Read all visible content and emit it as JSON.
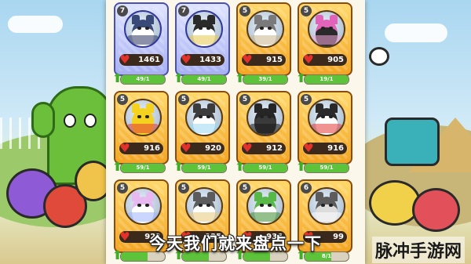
{
  "cards": [
    {
      "level": "7",
      "hp": "1461",
      "progress": "49/1",
      "fill": 1.0,
      "style": "blue",
      "face": "#3a4a78",
      "fur": "#ffffff",
      "accent": "#2d3561",
      "name": "dark-blue-dog"
    },
    {
      "level": "7",
      "hp": "1433",
      "progress": "49/1",
      "fill": 1.0,
      "style": "blue",
      "face": "#2a2a2a",
      "fur": "#ffffff",
      "accent": "#e7c84a",
      "name": "crowned-dog"
    },
    {
      "level": "5",
      "hp": "915",
      "progress": "39/1",
      "fill": 1.0,
      "style": "gold",
      "face": "#7a7a7a",
      "fur": "#ffffff",
      "accent": "#c9b58a",
      "name": "helmet-dog"
    },
    {
      "level": "5",
      "hp": "905",
      "progress": "19/1",
      "fill": 1.0,
      "style": "gold",
      "face": "#e264b8",
      "fur": "#2a2a2a",
      "accent": "#f2a6d8",
      "name": "pink-dog"
    },
    {
      "level": "5",
      "hp": "916",
      "progress": "59/1",
      "fill": 1.0,
      "style": "gold",
      "face": "#f4d21e",
      "fur": "#f4d21e",
      "accent": "#e23b3b",
      "name": "pikachu-dog"
    },
    {
      "level": "5",
      "hp": "920",
      "progress": "59/1",
      "fill": 1.0,
      "style": "gold",
      "face": "#3c3c3c",
      "fur": "#ffffff",
      "accent": "#9ad8f0",
      "name": "ice-dog"
    },
    {
      "level": "5",
      "hp": "912",
      "progress": "59/1",
      "fill": 1.0,
      "style": "gold",
      "face": "#262626",
      "fur": "#3a3a3a",
      "accent": "#1a1a1a",
      "name": "black-dog"
    },
    {
      "level": "5",
      "hp": "916",
      "progress": "59/1",
      "fill": 1.0,
      "style": "gold",
      "face": "#2a2a2a",
      "fur": "#ffffff",
      "accent": "#e23b3b",
      "name": "cap-dog"
    },
    {
      "level": "5",
      "hp": "92?",
      "progress": "",
      "fill": 0.6,
      "style": "gold",
      "face": "#e8b9f0",
      "fur": "#ffffff",
      "accent": "#9fb4ff",
      "name": "sparkle-dog"
    },
    {
      "level": "5",
      "hp": "935",
      "progress": "",
      "fill": 0.6,
      "style": "gold",
      "face": "#5c5c5c",
      "fur": "#ffffff",
      "accent": "#e9c97a",
      "name": "goggles-dog"
    },
    {
      "level": "5",
      "hp": "936",
      "progress": "",
      "fill": 0.6,
      "style": "gold",
      "face": "#58b848",
      "fur": "#ffffff",
      "accent": "#3c8c2c",
      "name": "frog-dog"
    },
    {
      "level": "6",
      "hp": "99",
      "progress": "8/1",
      "fill": 0.6,
      "style": "gold",
      "face": "#5c5c5c",
      "fur": "#dcdcdc",
      "accent": "#ffffff",
      "name": "fan-dog"
    }
  ],
  "subtitle": "今天我们就来盘点一下",
  "watermark": "脉冲手游网",
  "colors": {
    "panel": "#fbf7ea",
    "gold_frame": "#f3a623",
    "blue_frame": "#a7b1f3",
    "hp_heart": "#e2322b",
    "progress": "#5cc33b"
  }
}
